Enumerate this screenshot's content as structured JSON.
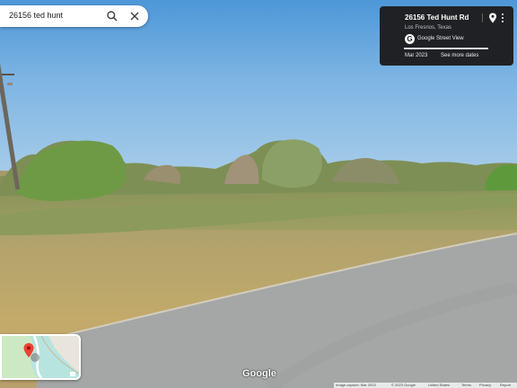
{
  "search": {
    "value": "26156 ted hunt"
  },
  "info_panel": {
    "title": "26156 Ted Hunt Rd",
    "subtitle": "Los Fresnos, Texas",
    "source_label": "Google Street View",
    "date": "Mar 2023",
    "see_more": "See more dates",
    "timeline_progress": 1.0
  },
  "watermark": "Google",
  "footer": {
    "capture": "Image capture: Mar 2023",
    "copyright": "© 2023 Google",
    "country": "United States",
    "terms": "Terms",
    "privacy": "Privacy",
    "report": "Report"
  },
  "icons": {
    "search": "search-icon",
    "close": "close-icon",
    "pin": "pin-icon",
    "more": "more-vert-icon",
    "map_pin": "map-pin-icon"
  },
  "colors": {
    "panel_bg": "#202124",
    "sky": "#6aaae0",
    "pin_red": "#ea4335"
  }
}
